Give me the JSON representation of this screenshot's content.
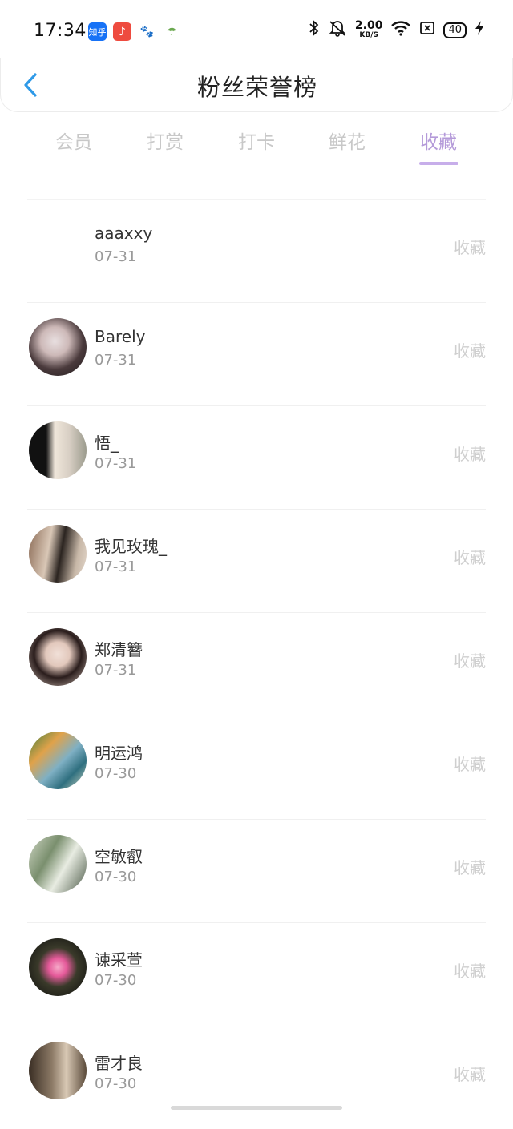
{
  "status_bar": {
    "time": "17:34",
    "apps": [
      {
        "icon": "zhihu-icon",
        "label": "知乎",
        "color": "#1772f6"
      },
      {
        "icon": "music-icon",
        "label": "♪",
        "color": "#ee4b3f"
      },
      {
        "icon": "baidu-icon",
        "label": "🐾",
        "color": "#ffffff"
      },
      {
        "icon": "assistant-icon",
        "label": "☂",
        "color": "#ffffff"
      }
    ],
    "net_speed_value": "2.00",
    "net_speed_unit": "KB/S",
    "battery": "40"
  },
  "header": {
    "title": "粉丝荣誉榜"
  },
  "tabs": [
    {
      "label": "会员",
      "active": false
    },
    {
      "label": "打赏",
      "active": false
    },
    {
      "label": "打卡",
      "active": false
    },
    {
      "label": "鲜花",
      "active": false
    },
    {
      "label": "收藏",
      "active": true
    }
  ],
  "fans": [
    {
      "name": "aaaxxy",
      "date": "07-31",
      "action": "收藏",
      "avatar": "none"
    },
    {
      "name": "Barely",
      "date": "07-31",
      "action": "收藏",
      "avatar": "a"
    },
    {
      "name": "悟_",
      "date": "07-31",
      "action": "收藏",
      "avatar": "b"
    },
    {
      "name": "我见玫瑰_",
      "date": "07-31",
      "action": "收藏",
      "avatar": "c"
    },
    {
      "name": "郑清簪",
      "date": "07-31",
      "action": "收藏",
      "avatar": "d"
    },
    {
      "name": "明运鸿",
      "date": "07-30",
      "action": "收藏",
      "avatar": "e"
    },
    {
      "name": "空敏叡",
      "date": "07-30",
      "action": "收藏",
      "avatar": "f"
    },
    {
      "name": "谏采萱",
      "date": "07-30",
      "action": "收藏",
      "avatar": "g"
    },
    {
      "name": "雷才良",
      "date": "07-30",
      "action": "收藏",
      "avatar": "h"
    }
  ],
  "colors": {
    "accent": "#b49ad9",
    "back_arrow": "#2f9ae8"
  }
}
